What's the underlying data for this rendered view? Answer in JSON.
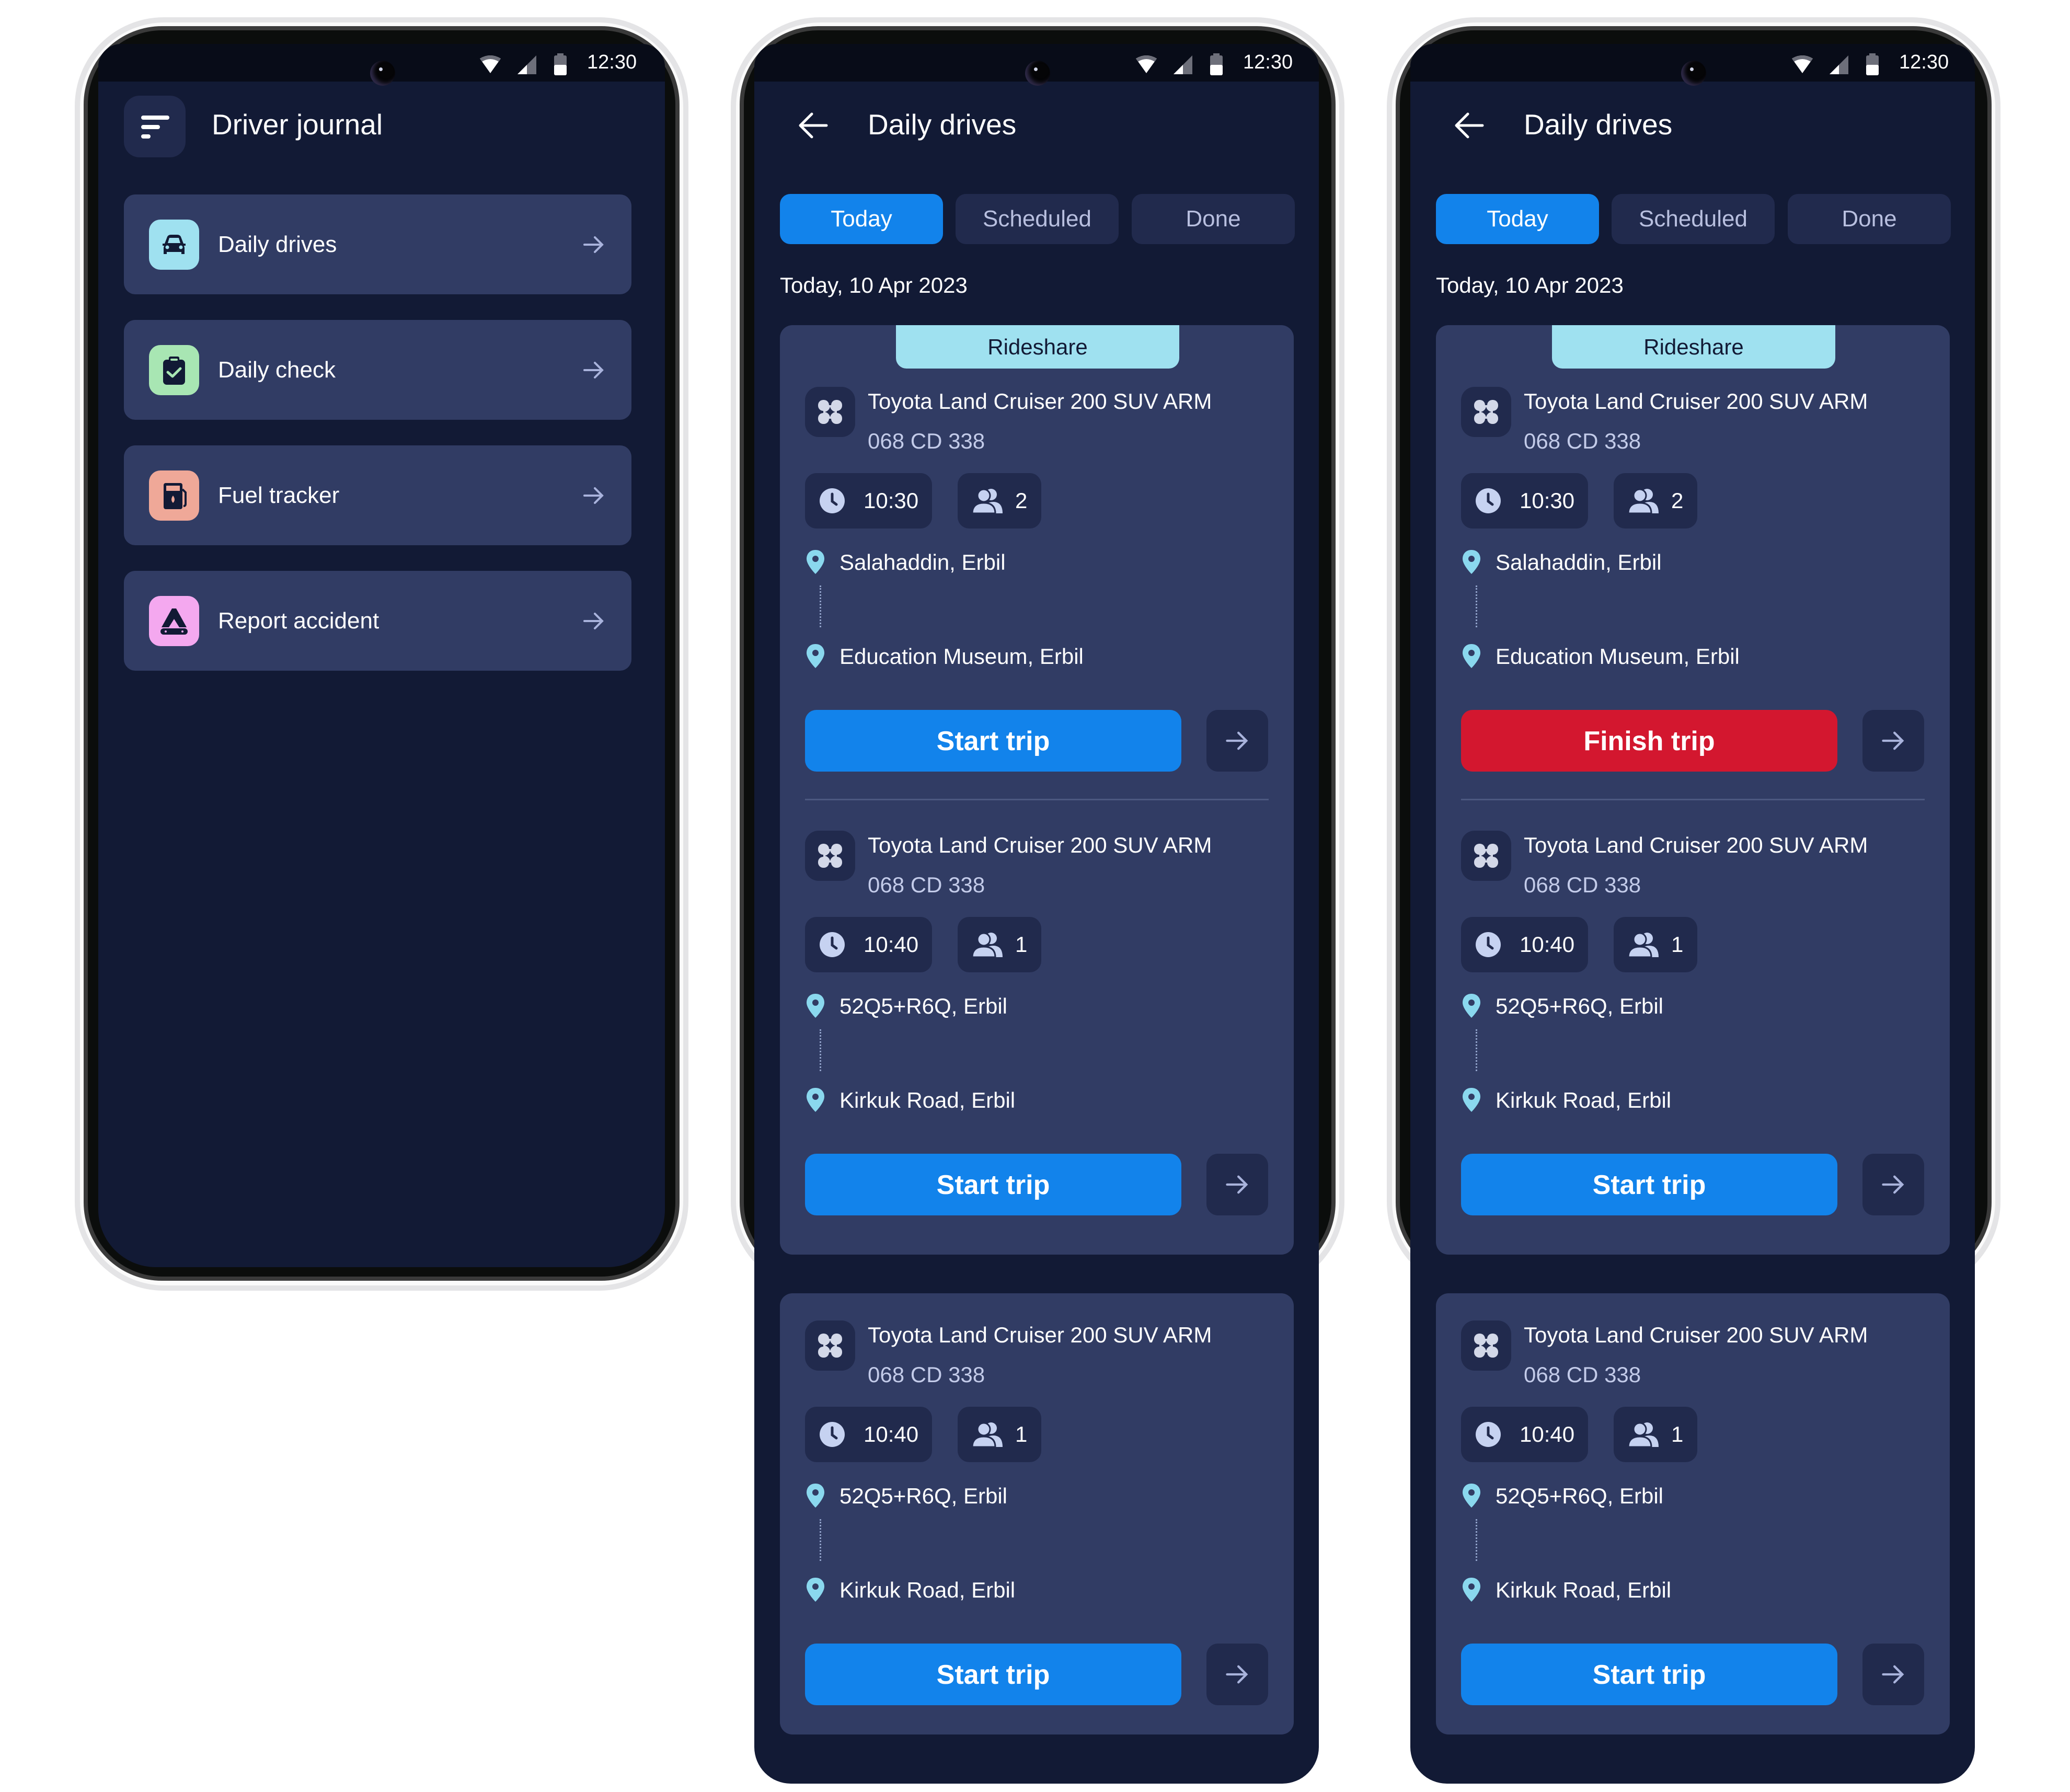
{
  "status_bar": {
    "time": "12:30",
    "icons": [
      "wifi-icon",
      "signal-icon",
      "battery-icon"
    ]
  },
  "screens": {
    "home": {
      "title": "Driver journal",
      "menu_icon": "menu-icon",
      "items": [
        {
          "label": "Daily drives",
          "icon": "car-icon",
          "icon_bg": "#9fe1f0"
        },
        {
          "label": "Daily check",
          "icon": "clipboard-check-icon",
          "icon_bg": "#a8e6b3"
        },
        {
          "label": "Fuel tracker",
          "icon": "fuel-pump-icon",
          "icon_bg": "#efa898"
        },
        {
          "label": "Report accident",
          "icon": "warning-triangle-icon",
          "icon_bg": "#f4a8ef"
        }
      ]
    },
    "daily_drives_start": {
      "title": "Daily drives",
      "tabs": [
        {
          "label": "Today",
          "active": true
        },
        {
          "label": "Scheduled",
          "active": false
        },
        {
          "label": "Done",
          "active": false
        }
      ],
      "date_label": "Today, 10 Apr 2023",
      "groups": [
        {
          "tag": "Rideshare",
          "trips": [
            {
              "vehicle": "Toyota Land Cruiser 200 SUV ARM",
              "plate": "068 CD 338",
              "time": "10:30",
              "passengers": "2",
              "from": "Salahaddin, Erbil",
              "to": "Education Museum, Erbil",
              "action": "Start trip",
              "action_state": "start"
            },
            {
              "vehicle": "Toyota Land Cruiser 200 SUV ARM",
              "plate": "068 CD 338",
              "time": "10:40",
              "passengers": "1",
              "from": "52Q5+R6Q, Erbil",
              "to": "Kirkuk Road, Erbil",
              "action": "Start trip",
              "action_state": "start"
            }
          ]
        },
        {
          "tag": null,
          "trips": [
            {
              "vehicle": "Toyota Land Cruiser 200 SUV ARM",
              "plate": "068 CD 338",
              "time": "10:40",
              "passengers": "1",
              "from": "52Q5+R6Q, Erbil",
              "to": "Kirkuk Road, Erbil",
              "action": "Start trip",
              "action_state": "start"
            }
          ]
        }
      ]
    },
    "daily_drives_finish": {
      "title": "Daily drives",
      "tabs": [
        {
          "label": "Today",
          "active": true
        },
        {
          "label": "Scheduled",
          "active": false
        },
        {
          "label": "Done",
          "active": false
        }
      ],
      "date_label": "Today, 10 Apr 2023",
      "groups": [
        {
          "tag": "Rideshare",
          "trips": [
            {
              "vehicle": "Toyota Land Cruiser 200 SUV ARM",
              "plate": "068 CD 338",
              "time": "10:30",
              "passengers": "2",
              "from": "Salahaddin, Erbil",
              "to": "Education Museum, Erbil",
              "action": "Finish trip",
              "action_state": "finish"
            },
            {
              "vehicle": "Toyota Land Cruiser 200 SUV ARM",
              "plate": "068 CD 338",
              "time": "10:40",
              "passengers": "1",
              "from": "52Q5+R6Q, Erbil",
              "to": "Kirkuk Road, Erbil",
              "action": "Start trip",
              "action_state": "start"
            }
          ]
        },
        {
          "tag": null,
          "trips": [
            {
              "vehicle": "Toyota Land Cruiser 200 SUV ARM",
              "plate": "068 CD 338",
              "time": "10:40",
              "passengers": "1",
              "from": "52Q5+R6Q, Erbil",
              "to": "Kirkuk Road, Erbil",
              "action": "Start trip",
              "action_state": "start"
            }
          ]
        }
      ]
    }
  },
  "colors": {
    "app_bg": "#121a35",
    "card_bg": "#313c64",
    "chip_bg": "#212a4d",
    "primary": "#1283eb",
    "danger": "#d3172f",
    "tag_bg": "#9fe1f0",
    "pin": "#8ad8ee"
  }
}
